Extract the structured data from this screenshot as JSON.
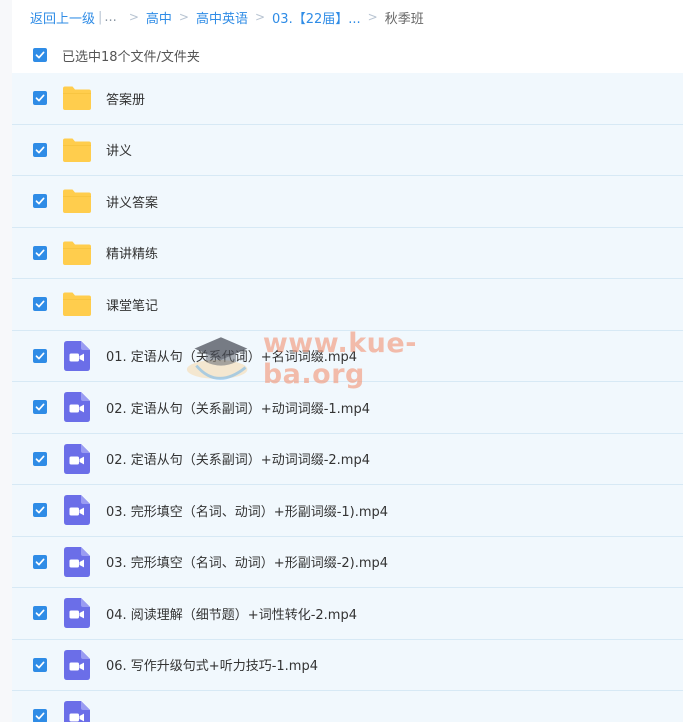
{
  "breadcrumb": {
    "back_label": "返回上一级",
    "separator": "|",
    "ellipsis": "...",
    "crumbs": [
      {
        "label": "高中"
      },
      {
        "label": "高中英语"
      },
      {
        "label": "03.【22届】..."
      }
    ],
    "current": "秋季班",
    "arrow": ">"
  },
  "selection": {
    "text": "已选中18个文件/文件夹",
    "checked": true
  },
  "files": [
    {
      "name": "答案册",
      "type": "folder",
      "checked": true
    },
    {
      "name": "讲义",
      "type": "folder",
      "checked": true
    },
    {
      "name": "讲义答案",
      "type": "folder",
      "checked": true
    },
    {
      "name": "精讲精练",
      "type": "folder",
      "checked": true
    },
    {
      "name": "课堂笔记",
      "type": "folder",
      "checked": true
    },
    {
      "name": "01. 定语从句（关系代词）+名词词缀.mp4",
      "type": "video",
      "checked": true
    },
    {
      "name": "02. 定语从句（关系副词）+动词词缀-1.mp4",
      "type": "video",
      "checked": true
    },
    {
      "name": "02. 定语从句（关系副词）+动词词缀-2.mp4",
      "type": "video",
      "checked": true
    },
    {
      "name": "03. 完形填空（名词、动词）+形副词缀-1).mp4",
      "type": "video",
      "checked": true
    },
    {
      "name": "03. 完形填空（名词、动词）+形副词缀-2).mp4",
      "type": "video",
      "checked": true
    },
    {
      "name": "04. 阅读理解（细节题）+词性转化-2.mp4",
      "type": "video",
      "checked": true
    },
    {
      "name": "06. 写作升级句式+听力技巧-1.mp4",
      "type": "video",
      "checked": true
    },
    {
      "name": "",
      "type": "video",
      "checked": true
    }
  ],
  "watermark": {
    "text": "www.kue-ba.org"
  },
  "colors": {
    "accent": "#2f8ce6",
    "row_bg": "#f1f8fd",
    "folder": "#ffcd4d",
    "video": "#6b6ee8"
  }
}
